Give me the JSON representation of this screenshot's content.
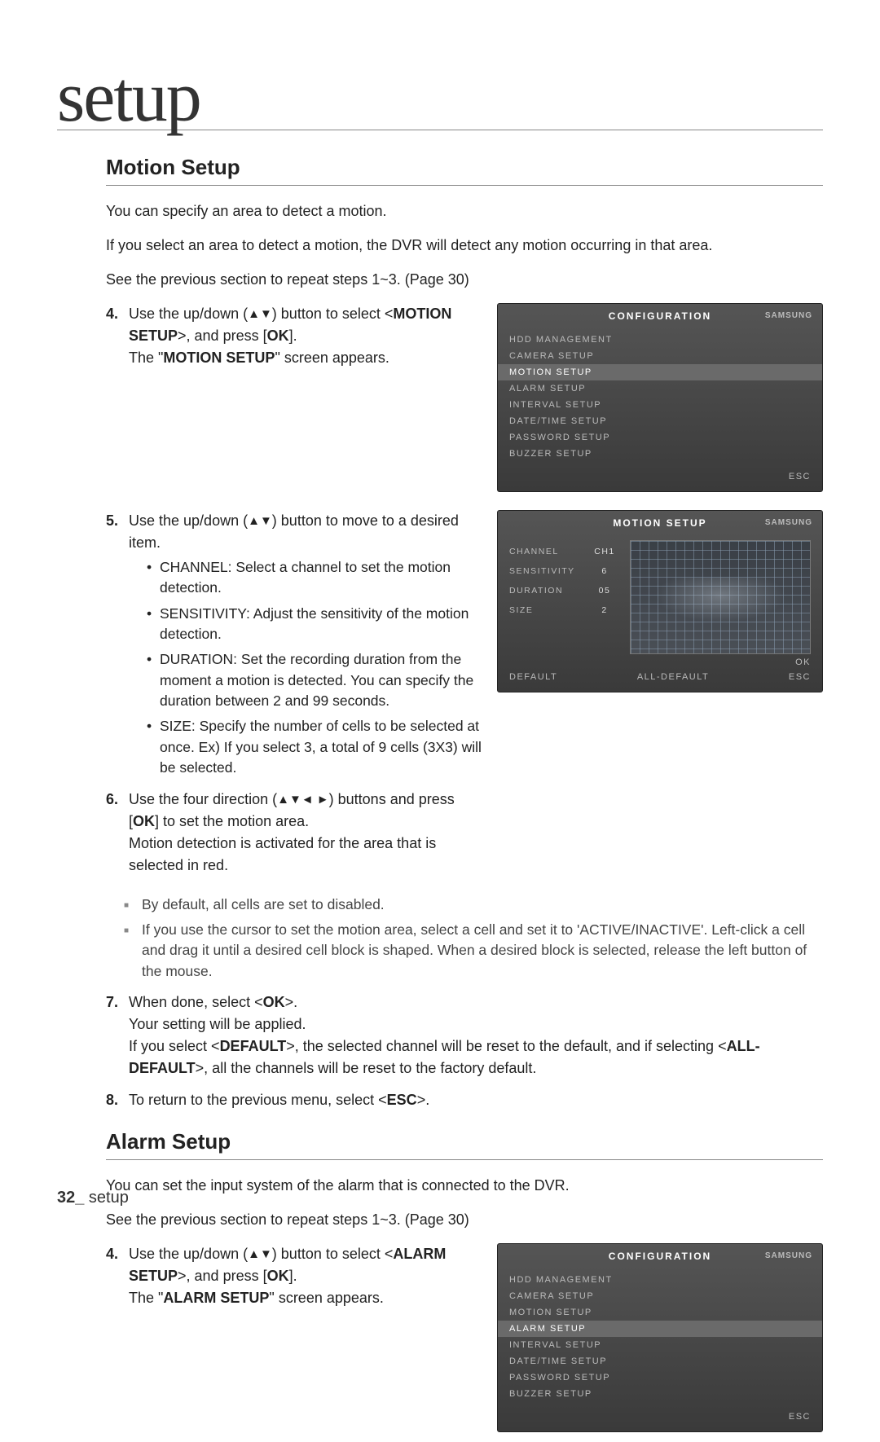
{
  "page": {
    "title": "setup",
    "footer_page": "32_",
    "footer_text": " setup"
  },
  "motion": {
    "heading": "Motion Setup",
    "intro1": "You can specify an area to detect a motion.",
    "intro2": "If you select an area to detect a motion, the DVR will detect any motion occurring in that area.",
    "intro3": "See the previous section to repeat steps 1~3. (Page 30)",
    "step4": {
      "num": "4.",
      "text_a": "Use the up/down (",
      "arrows": "▲▼",
      "text_b": ") button to select <",
      "label": "MOTION SETUP",
      "text_c": ">, and press [",
      "ok": "OK",
      "text_d": "].",
      "line2a": "The \"",
      "line2b": "MOTION SETUP",
      "line2c": "\" screen appears."
    },
    "step5": {
      "num": "5.",
      "text_a": "Use the up/down (",
      "arrows": "▲▼",
      "text_b": ") button to move to a desired item.",
      "bullets": [
        "CHANNEL: Select a channel to set the motion detection.",
        "SENSITIVITY: Adjust the sensitivity of the motion detection.",
        "DURATION: Set the recording duration from the moment a motion is detected. You can specify the duration between 2 and 99 seconds.",
        "SIZE: Specify the number of cells to be selected at once. Ex) If you select 3, a total of 9 cells (3X3) will be selected."
      ]
    },
    "step6": {
      "num": "6.",
      "text_a": "Use the four direction (",
      "arrows": "▲▼◄ ►",
      "text_b": ") buttons and press [",
      "ok": "OK",
      "text_c": "] to set the motion area.",
      "line2": "Motion detection is activated for the area that is selected in red.",
      "notes": [
        "By default, all cells are set to disabled.",
        "If you use the cursor to set the motion area, select a cell and set it to 'ACTIVE/INACTIVE'. Left-click a cell and drag it until a desired cell block is shaped. When a desired block is selected, release the left button of the mouse."
      ]
    },
    "step7": {
      "num": "7.",
      "l1a": "When done, select <",
      "l1b": "OK",
      "l1c": ">.",
      "l2": "Your setting will be applied.",
      "l3a": "If you select <",
      "l3b": "DEFAULT",
      "l3c": ">, the selected channel will be reset to the default, and if selecting <",
      "l3d": "ALL-DEFAULT",
      "l3e": ">, all the channels will be reset to the factory default."
    },
    "step8": {
      "num": "8.",
      "a": "To return to the previous menu, select <",
      "b": "ESC",
      "c": ">."
    }
  },
  "alarm": {
    "heading": "Alarm Setup",
    "intro1": "You can set the input system of the alarm that is connected to the DVR.",
    "intro2": "See the previous section to repeat steps 1~3. (Page 30)",
    "step4": {
      "num": "4.",
      "text_a": "Use the up/down (",
      "arrows": "▲▼",
      "text_b": ") button to select <",
      "label": "ALARM SETUP",
      "text_c": ">, and press [",
      "ok": "OK",
      "text_d": "].",
      "line2a": "The \"",
      "line2b": "ALARM SETUP",
      "line2c": "\" screen appears."
    }
  },
  "osd_config": {
    "title": "CONFIGURATION",
    "brand": "SAMSUNG",
    "items": [
      "HDD MANAGEMENT",
      "CAMERA SETUP",
      "MOTION SETUP",
      "ALARM SETUP",
      "INTERVAL SETUP",
      "DATE/TIME SETUP",
      "PASSWORD SETUP",
      "BUZZER SETUP"
    ],
    "esc": "ESC"
  },
  "osd_motion": {
    "title": "MOTION SETUP",
    "brand": "SAMSUNG",
    "labels": [
      "CHANNEL",
      "SENSITIVITY",
      "DURATION",
      "SIZE"
    ],
    "values": [
      "CH1",
      "6",
      "05",
      "2"
    ],
    "ok": "OK",
    "default": "DEFAULT",
    "all_default": "ALL-DEFAULT",
    "esc": "ESC"
  }
}
